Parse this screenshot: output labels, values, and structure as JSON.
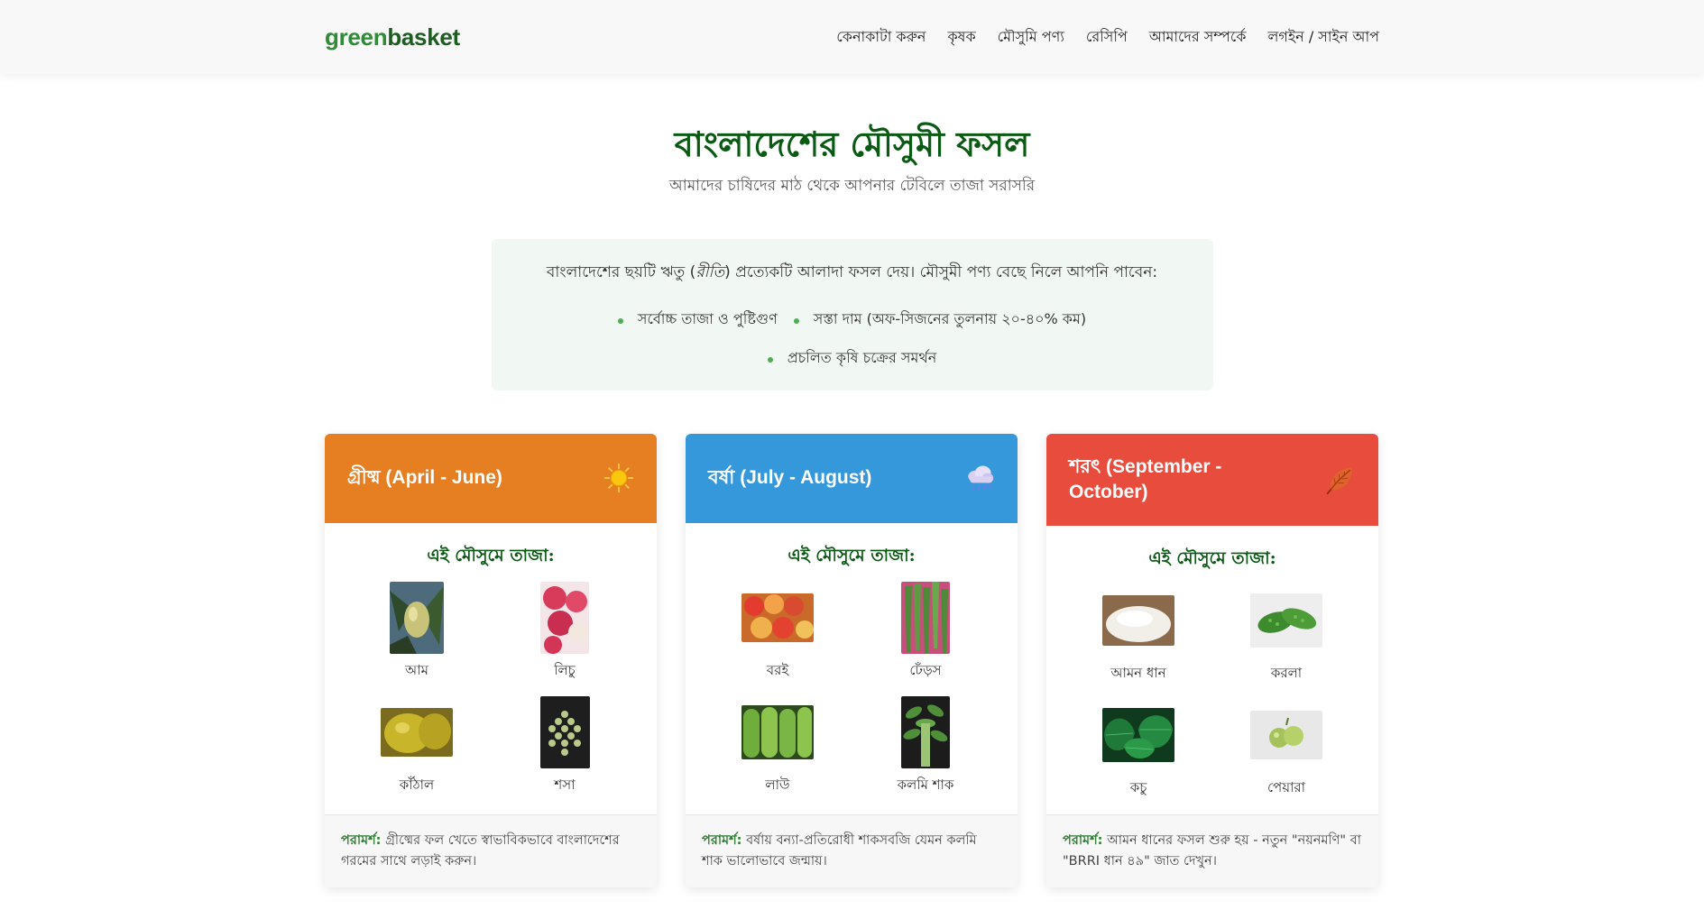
{
  "nav": {
    "brand_part1": "green",
    "brand_part2": "basket",
    "links": [
      "কেনাকাটা করুন",
      "কৃষক",
      "মৌসুমি পণ্য",
      "রেসিপি",
      "আমাদের সম্পর্কে",
      "লগইন / সাইন আপ"
    ]
  },
  "hero": {
    "title": "বাংলাদেশের মৌসুমী ফসল",
    "subtitle": "আমাদের চাষিদের মাঠ থেকে আপনার টেবিলে তাজা সরাসরি"
  },
  "intro": {
    "text_before": "বাংলাদেশের ছয়টি ঋতু (",
    "text_em": "রীতি",
    "text_after": ") প্রত্যেকটি আলাদা ফসল দেয়। মৌসুমী পণ্য বেছে নিলে আপনি পাবেন:",
    "benefits": [
      "সর্বোচ্চ তাজা ও পুষ্টিগুণ",
      "সস্তা দাম (অফ-সিজনের তুলনায় ২০-৪০% কম)",
      "প্রচলিত কৃষি চক্রের সমর্থন"
    ]
  },
  "seasons": [
    {
      "title": "গ্রীষ্ম (April - June)",
      "icon": "sun-icon",
      "fresh_label": "এই মৌসুমে তাজা:",
      "produce": [
        {
          "name": "আম",
          "image": "mango-image"
        },
        {
          "name": "লিচু",
          "image": "litchi-image"
        },
        {
          "name": "কাঁঠাল",
          "image": "jackfruit-image"
        },
        {
          "name": "শসা",
          "image": "cucumber-image"
        }
      ],
      "tip_label": "পরামর্শ:",
      "tip_text": "গ্রীষ্মের ফল খেতে স্বাভাবিকভাবে বাংলাদেশের গরমের সাথে লড়াই করুন।"
    },
    {
      "title": "বর্ষা (July - August)",
      "icon": "rain-cloud-icon",
      "fresh_label": "এই মৌসুমে তাজা:",
      "produce": [
        {
          "name": "বরই",
          "image": "jujube-image"
        },
        {
          "name": "ঢেঁড়স",
          "image": "okra-image"
        },
        {
          "name": "লাউ",
          "image": "bottle-gourd-image"
        },
        {
          "name": "কলমি শাক",
          "image": "water-spinach-image"
        }
      ],
      "tip_label": "পরামর্শ:",
      "tip_text": "বর্ষায় বন্যা-প্রতিরোধী শাকসবজি যেমন কলমি শাক ভালোভাবে জন্মায়।"
    },
    {
      "title": "শরৎ (September - October)",
      "icon": "autumn-leaf-icon",
      "fresh_label": "এই মৌসুমে তাজা:",
      "produce": [
        {
          "name": "আমন ধান",
          "image": "aman-rice-image"
        },
        {
          "name": "করলা",
          "image": "bitter-gourd-image"
        },
        {
          "name": "কচু",
          "image": "taro-leaf-image"
        },
        {
          "name": "পেয়ারা",
          "image": "guava-image"
        }
      ],
      "tip_label": "পরামর্শ:",
      "tip_text": "আমন ধানের ফসল শুরু হয় - নতুন \"নয়নমণি\" বা \"BRRI ধান ৪৯\" জাত দেখুন।"
    }
  ],
  "colors": {
    "summer": "#e67e22",
    "monsoon": "#3498db",
    "autumn": "#e74c3c",
    "primary_green": "#0a5a14",
    "intro_bg": "#f1f7f2"
  }
}
